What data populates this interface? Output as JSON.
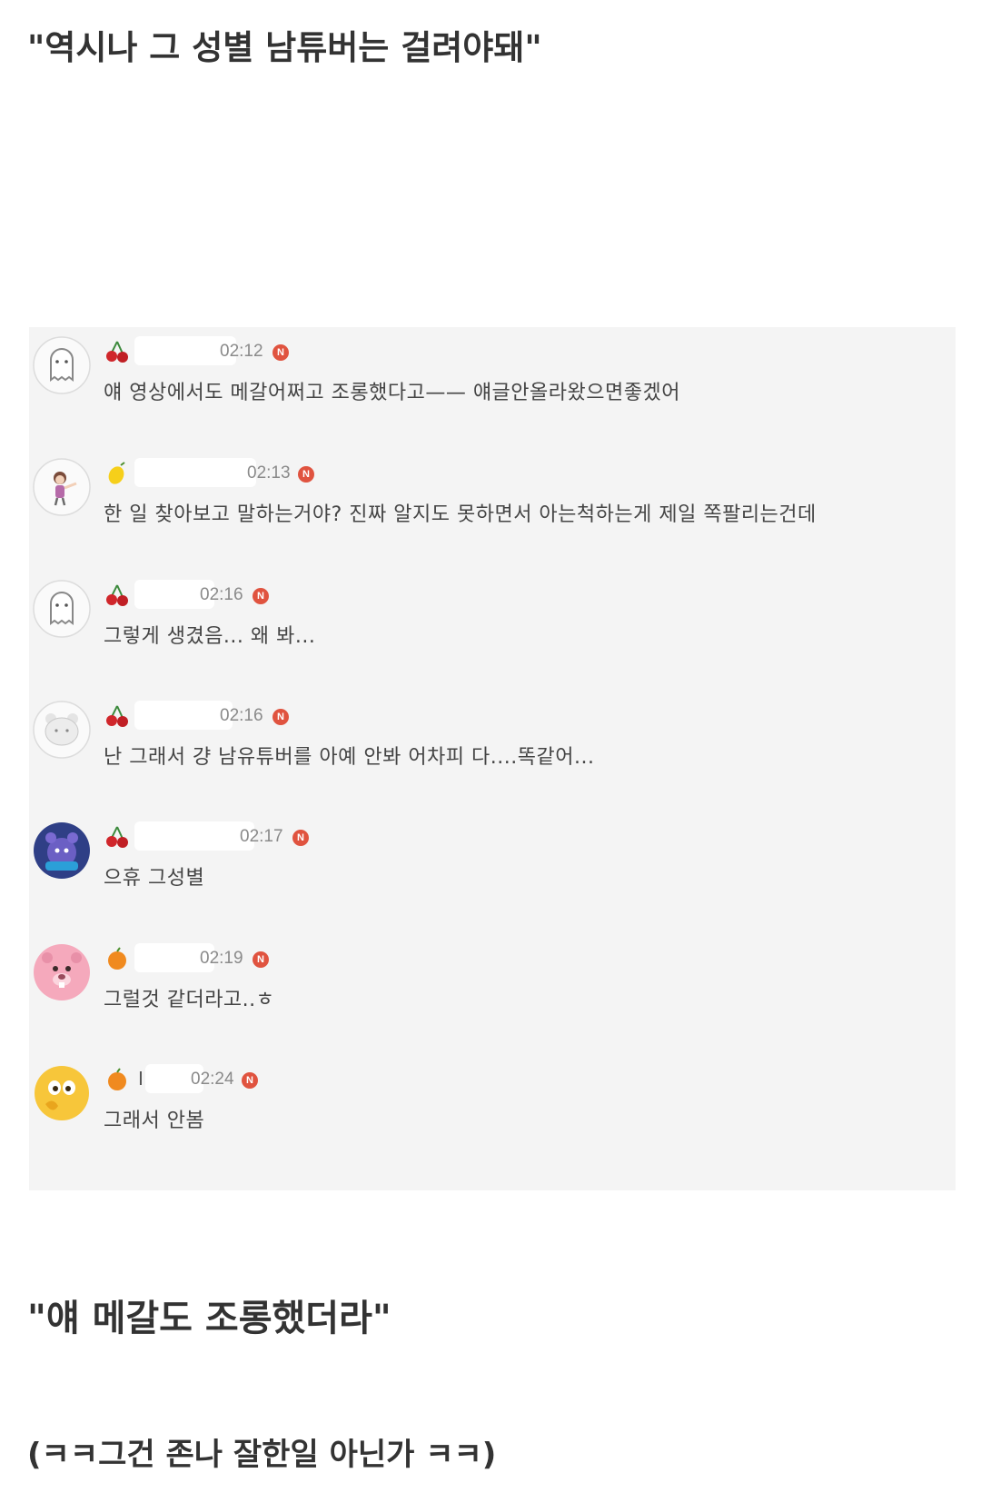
{
  "headings": {
    "top": "\"역시나 그 성별 남튜버는 걸려야돼\"",
    "middle": "\"얘 메갈도 조롱했더라\"",
    "bottom": "(ㅋㅋ그건 존나 잘한일 아닌가 ㅋㅋ)"
  },
  "comments": [
    {
      "avatar": "ghost-avatar-icon",
      "badge": "cherry-icon",
      "name_fragment": "",
      "time": "02:12",
      "new_label": "N",
      "text": "얘 영상에서도 메갈어쩌고 조롱했다고—— 얘글안올라왔으면좋겠어"
    },
    {
      "avatar": "girl-avatar-icon",
      "badge": "lemon-icon",
      "name_fragment": "",
      "time": "02:13",
      "new_label": "N",
      "text": "한 일 찾아보고 말하는거야? 진짜 알지도 못하면서 아는척하는게 제일 쪽팔리는건데"
    },
    {
      "avatar": "ghost-avatar-icon",
      "badge": "cherry-icon",
      "name_fragment": "",
      "time": "02:16",
      "new_label": "N",
      "text": "그렇게 생겼음... 왜 봐..."
    },
    {
      "avatar": "bear-avatar-icon",
      "badge": "cherry-icon",
      "name_fragment": "",
      "time": "02:16",
      "new_label": "N",
      "text": "난 그래서 걍 남유튜버를 아예 안봐 어차피 다....똑같어..."
    },
    {
      "avatar": "character-avatar-icon",
      "badge": "cherry-icon",
      "name_fragment": "",
      "time": "02:17",
      "new_label": "N",
      "text": "으휴 그성별"
    },
    {
      "avatar": "pink-beaver-avatar-icon",
      "badge": "orange-icon",
      "name_fragment": "",
      "time": "02:19",
      "new_label": "N",
      "text": "그럴것 같더라고..ㅎ"
    },
    {
      "avatar": "emoji-avatar-icon",
      "badge": "orange-icon",
      "name_fragment": "I",
      "time": "02:24",
      "new_label": "N",
      "text": "그래서 안봄"
    }
  ],
  "colors": {
    "panel": "#f4f4f4",
    "new_badge": "#e0533f",
    "heading": "#333333",
    "time": "#8a8a8a"
  }
}
